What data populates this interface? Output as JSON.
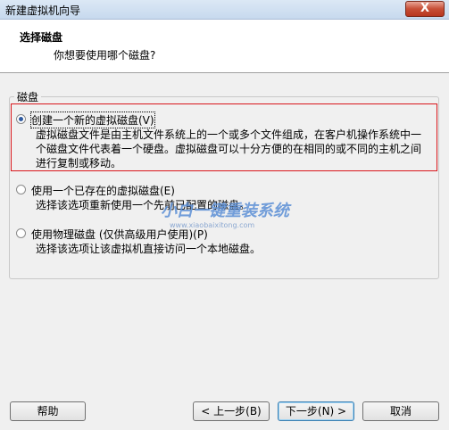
{
  "window": {
    "title": "新建虚拟机向导",
    "close_glyph": "X"
  },
  "header": {
    "title": "选择磁盘",
    "subtitle": "你想要使用哪个磁盘?"
  },
  "group": {
    "legend": "磁盘"
  },
  "options": [
    {
      "label": "创建一个新的虚拟磁盘(V)",
      "checked": true,
      "description": "虚拟磁盘文件是由主机文件系统上的一个或多个文件组成，在客户机操作系统中一个磁盘文件代表着一个硬盘。虚拟磁盘可以十分方便的在相同的或不同的主机之间进行复制或移动。"
    },
    {
      "label": "使用一个已存在的虚拟磁盘(E)",
      "checked": false,
      "description": "选择该选项重新使用一个先前已配置的磁盘。"
    },
    {
      "label": "使用物理磁盘 (仅供高级用户使用)(P)",
      "checked": false,
      "description": "选择该选项让该虚拟机直接访问一个本地磁盘。"
    }
  ],
  "watermark": {
    "text": "小白一键重装系统",
    "url": "www.xiaobaixitong.com"
  },
  "buttons": {
    "help": "帮助",
    "back": "< 上一步(B)",
    "next": "下一步(N) >",
    "cancel": "取消"
  }
}
